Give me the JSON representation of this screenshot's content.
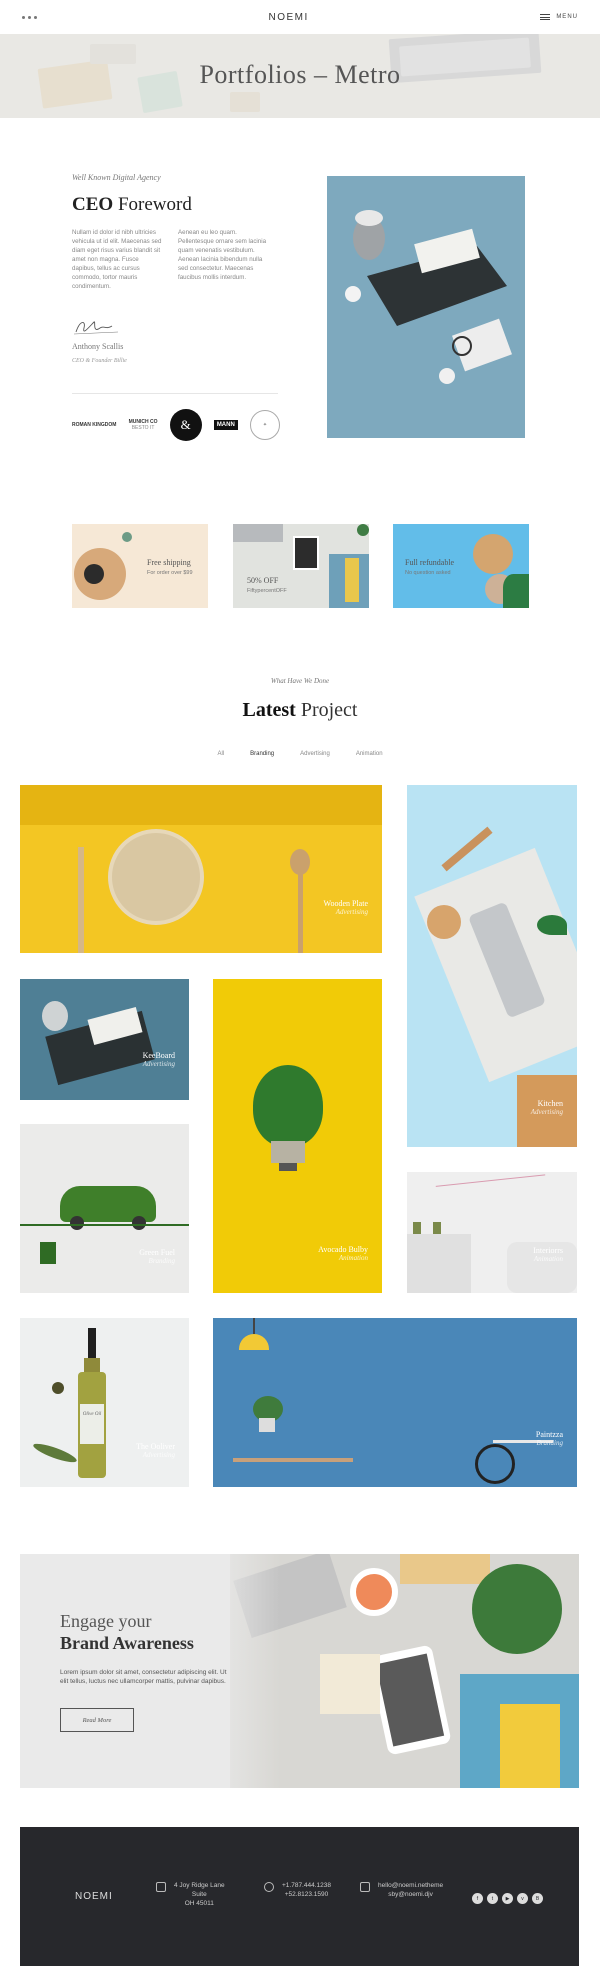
{
  "header": {
    "logo": "NOEMI",
    "menu_label": "MENU"
  },
  "hero": {
    "title": "Portfolios – Metro"
  },
  "ceo": {
    "subtitle": "Well Known Digital Agency",
    "title_bold": "CEO",
    "title_rest": "Foreword",
    "col1": "Nullam id dolor id nibh ultricies vehicula ut id elit. Maecenas sed diam eget risus varius blandit sit amet non magna. Fusce dapibus, tellus ac cursus commodo, tortor mauris condimentum.",
    "col2": "Aenean eu leo quam. Pellentesque ornare sem lacinia quam venenatis vestibulum. Aenean lacinia bibendum nulla sed consectetur. Maecenas faucibus mollis interdum.",
    "name": "Anthony Scallis",
    "role": "CEO & Founder Billie"
  },
  "brands": {
    "b1": "ROMAN KINGDOM",
    "b2": "MUNICH CO",
    "b2_sub": "BESTO IT",
    "b3": "&",
    "b4": "MANN"
  },
  "promos": [
    {
      "line1": "Free shipping",
      "line2": "For order over $99"
    },
    {
      "line1": "50% OFF",
      "line2": "FiftypercentOFF"
    },
    {
      "line1": "Full refundable",
      "line2": "No question asked"
    }
  ],
  "latest": {
    "subtitle": "What Have We Done",
    "title_bold": "Latest",
    "title_rest": "Project",
    "filters": [
      "All",
      "Branding",
      "Advertising",
      "Animation"
    ]
  },
  "projects": [
    {
      "name": "Wooden Plate",
      "category": "Advertising"
    },
    {
      "name": "Kitchen",
      "category": "Advertising"
    },
    {
      "name": "KeeBoard",
      "category": "Advertising"
    },
    {
      "name": "Avocado Bulby",
      "category": "Animation"
    },
    {
      "name": "Green Fuel",
      "category": "Branding"
    },
    {
      "name": "Interiorrs",
      "category": "Animation"
    },
    {
      "name": "The Ooliver",
      "category": "Advertising"
    },
    {
      "name": "Paintzza",
      "category": "Branding"
    }
  ],
  "bottle_label": "Olive Oil",
  "cta": {
    "line1": "Engage your",
    "line2": "Brand Awareness",
    "text": "Lorem ipsum dolor sit amet, consectetur adipiscing elit. Ut elit tellus, luctus nec ullamcorper mattis, pulvinar dapibus.",
    "button": "Read More"
  },
  "footer": {
    "logo": "NOEMI",
    "address": [
      "4 Joy Ridge Lane",
      "Suite",
      "OH 45011"
    ],
    "phones": [
      "+1.787.444.1238",
      "+52.8123.1590"
    ],
    "emails": [
      "hello@noemi.netheme",
      "sby@noemi.djv"
    ]
  },
  "colors": {
    "accent": "#222222",
    "footer_bg": "#27282c",
    "hero_bg": "#e9e8e4"
  }
}
